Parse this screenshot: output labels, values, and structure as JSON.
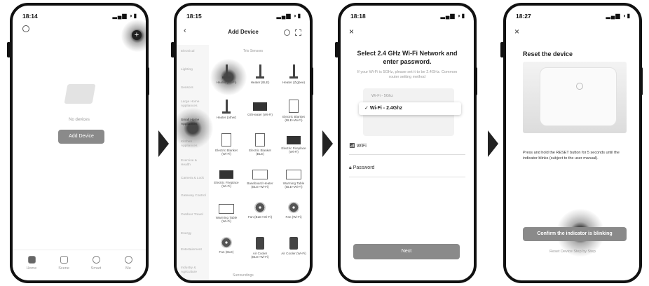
{
  "screen1": {
    "time": "18:14",
    "empty_text": "No devices",
    "add_button": "Add Device",
    "nav": [
      {
        "label": "Home",
        "icon": "home-icon"
      },
      {
        "label": "Scene",
        "icon": "scene-icon"
      },
      {
        "label": "Smart",
        "icon": "smart-icon"
      },
      {
        "label": "Me",
        "icon": "profile-icon"
      }
    ]
  },
  "screen2": {
    "time": "18:15",
    "title": "Add Device",
    "categories": [
      "Electrical",
      "Lighting",
      "Sensors",
      "Large Home Appliances",
      "Small Home Appliances",
      "Kitchen Appliances",
      "Exercise & Health",
      "Camera & Lock",
      "Gateway Control",
      "Outdoor Travel",
      "Energy",
      "Entertainment",
      "Industry & Agriculture"
    ],
    "section_top": "Trio Sensors",
    "section_bottom": "Surroundings",
    "grid": [
      [
        "Heater (Wi-Fi)",
        "Heater (BLE)",
        "Heater (Zigbee)"
      ],
      [
        "Heater (other)",
        "Oil Heater (Wi-Fi)",
        "Electric Blanket (BLE+Wi-Fi)"
      ],
      [
        "Electric Blanket (Wi-Fi)",
        "Electric Blanket (BLE)",
        "Electric Fireplace (Wi-Fi)"
      ],
      [
        "Electric Fireplace (Wi-Fi)",
        "Baseboard Heater (BLE+Wi-Fi)",
        "Warming Table (BLE+Wi-Fi)"
      ],
      [
        "Warming Table (Wi-Fi)",
        "Fan (BLE+Wi-Fi)",
        "Fan (Wi-Fi)"
      ],
      [
        "Fan (BLE)",
        "Air Cooler (BLE+Wi-Fi)",
        "Air Cooler (Wi-Fi)"
      ]
    ]
  },
  "screen3": {
    "time": "18:18",
    "title": "Select 2.4 GHz Wi-Fi Network and enter password.",
    "subtitle": "If your Wi-Fi is 5GHz, please set it to be 2.4GHz. Common router setting method",
    "wifi_5g": "Wi-Fi - 5Ghz",
    "wifi_24g": "Wi-Fi - 2.4Ghz",
    "wifi_field": "WiFi",
    "password_field": "Password",
    "next_button": "Next"
  },
  "screen4": {
    "time": "18:27",
    "title": "Reset the device",
    "instruction": "Press and hold the RESET button for 5 seconds until the indicator blinks (subject to the user manual).",
    "confirm_button": "Confirm the indicator is blinking",
    "help_link": "Reset Device Step by Step"
  }
}
